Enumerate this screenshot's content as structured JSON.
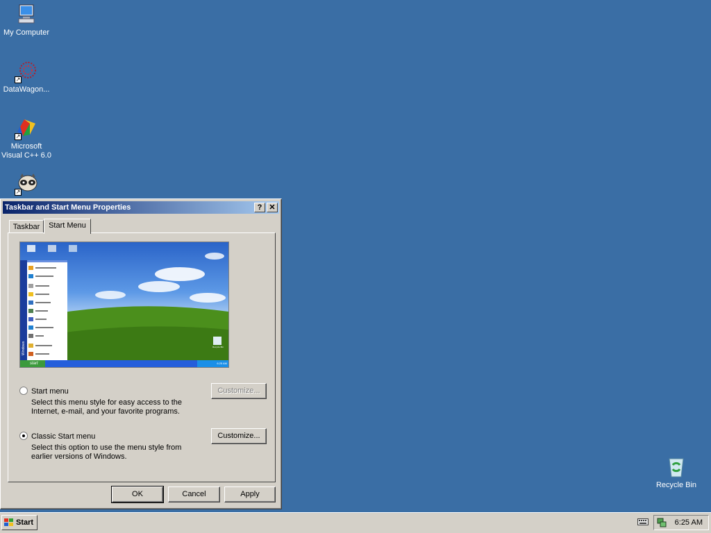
{
  "desktop": {
    "background": "#3a6ea5",
    "icons": [
      {
        "name": "my-computer-icon",
        "label": "My Computer"
      },
      {
        "name": "datawagon-icon",
        "label": "DataWagon..."
      },
      {
        "name": "visual-cpp-icon",
        "label": "Microsoft Visual C++ 6.0"
      },
      {
        "name": "raccoon-app-icon",
        "label": ""
      },
      {
        "name": "recycle-bin-icon",
        "label": "Recycle Bin"
      }
    ]
  },
  "dialog": {
    "title": "Taskbar and Start Menu Properties",
    "help_glyph": "?",
    "close_glyph": "✕",
    "tabs": [
      {
        "label": "Taskbar",
        "active": false
      },
      {
        "label": "Start Menu",
        "active": true
      }
    ],
    "preview": {
      "taskbar_start_label": "start",
      "clock": "6:25 AM",
      "os_label": "Windows",
      "recycle_label": "Recycle Bin"
    },
    "options": [
      {
        "label": "Start menu",
        "description": "Select this menu style for easy access to the Internet, e-mail, and your favorite programs.",
        "selected": false,
        "customize_label": "Customize...",
        "customize_enabled": false
      },
      {
        "label": "Classic Start menu",
        "description": "Select this option to use the menu style from earlier versions of Windows.",
        "selected": true,
        "customize_label": "Customize...",
        "customize_enabled": true
      }
    ],
    "buttons": {
      "ok": "OK",
      "cancel": "Cancel",
      "apply": "Apply"
    }
  },
  "taskbar": {
    "start_label": "Start",
    "clock": "6:25 AM",
    "tray_icons": [
      "keyboard-icon",
      "network-icon"
    ]
  }
}
